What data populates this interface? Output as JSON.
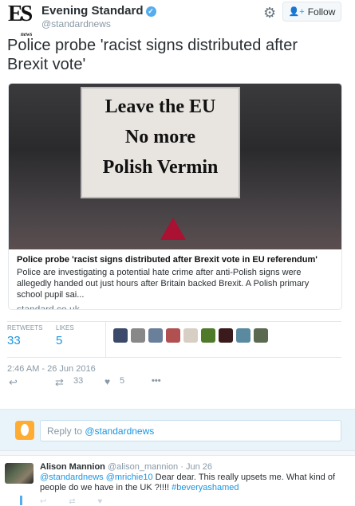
{
  "header": {
    "logo_text": "ES",
    "logo_sub": "news",
    "name": "Evening Standard",
    "handle": "@standardnews",
    "follow_label": "Follow"
  },
  "tweet": {
    "text": "Police probe 'racist signs distributed after Brexit vote'",
    "card": {
      "image_sign_lines": [
        "Leave the EU",
        "No more",
        "Polish Vermin"
      ],
      "title": "Police probe 'racist signs distributed after Brexit vote in EU referendum'",
      "description": "Police are investigating a potential hate crime after anti-Polish signs were allegedly handed out just hours after Britain backed Brexit. A Polish primary school pupil sai...",
      "domain": "standard.co.uk"
    },
    "stats": {
      "retweets_label": "Retweets",
      "retweets": "33",
      "likes_label": "Likes",
      "likes": "5"
    },
    "liker_avatar_colors": [
      "#3b4a6b",
      "#888888",
      "#6a7f9a",
      "#b05050",
      "#d8cfc4",
      "#4f7a2a",
      "#3a1a1a",
      "#5a8aa0",
      "#5a6a50"
    ],
    "timestamp": "2:46 AM - 26 Jun 2016",
    "actions": {
      "retweet_count": "33",
      "like_count": "5"
    }
  },
  "reply_box": {
    "prefix": "Reply to ",
    "mention": "@standardnews"
  },
  "reply": {
    "name": "Alison Mannion",
    "handle": "@alison_mannion",
    "date": "· Jun 26",
    "mentions": "@standardnews @mrichie10",
    "text": " Dear dear. This really upsets me. What kind of people do we have in the UK ?!!!! ",
    "hashtag": "#beveryashamed"
  }
}
